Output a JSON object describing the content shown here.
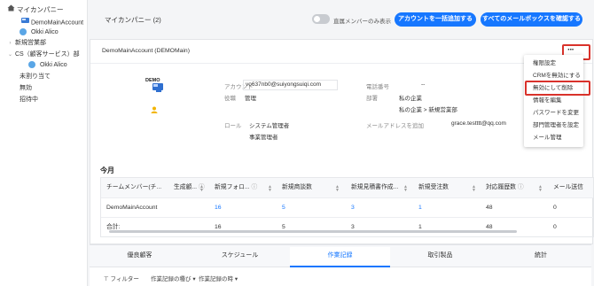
{
  "sidebar": {
    "root_label": "マイカンパニー",
    "items": [
      {
        "label": "DemoMainAccount"
      },
      {
        "label": "Okki Alico"
      },
      {
        "label": "新規営業部"
      },
      {
        "label": "CS（顧客サービス）部"
      },
      {
        "label": "Okki Alico"
      },
      {
        "label": "未割り当て"
      },
      {
        "label": "無効"
      },
      {
        "label": "招待中"
      }
    ]
  },
  "topbar": {
    "company_title": "マイカンパニー (2)",
    "direct_only_label": "直属メンバーのみ表示",
    "bulk_add_button": "アカウントを一括追加する",
    "check_mailbox_button": "すべてのメールボックスを確認する"
  },
  "card": {
    "account_header": "DemoMainAccount (DEMOMain)",
    "more_label": "···",
    "logo_text": "DEMO",
    "fields": {
      "account_label": "アカウント",
      "account_value": "vo637nb0@suiyongsuiqi.com",
      "role_title_label": "役職",
      "role_title_value": "管理",
      "phone_label": "電話番号",
      "phone_value": "--",
      "department_label": "部署",
      "department_value1": "私の企業",
      "department_value2": "私の企業 > 新規営業部",
      "role_label": "ロール",
      "role_value1": "システム管理者",
      "role_value2": "事業管理者",
      "mail_label": "メールアドレスを追加",
      "mail_value": "grace.testttt@qq.com"
    },
    "month_title": "今月",
    "table": {
      "headers": [
        "チームメンバー(チ...",
        "生成顧...",
        "新規フォロ...",
        "新規商談数",
        "新規見積書作成...",
        "新規受注数",
        "対応履歴数",
        "メール送信"
      ],
      "rows": [
        [
          "DemoMainAccount",
          "",
          "16",
          "5",
          "3",
          "1",
          "48",
          "0"
        ],
        [
          "合計:",
          "",
          "16",
          "5",
          "3",
          "1",
          "48",
          "0"
        ]
      ]
    }
  },
  "menu": {
    "items": [
      "権限設定",
      "CRMを無効にする",
      "無効にして削除",
      "情報を編集",
      "パスワードを変更",
      "部門管理者を設定",
      "メール管理"
    ]
  },
  "tabs": [
    "優良顧客",
    "スケジュール",
    "作業記録",
    "取引製品",
    "統計"
  ],
  "active_tab": "作業記録",
  "filters": {
    "filter_label": "フィルター",
    "type_label": "作業記録の種び",
    "time_label": "作業記録の時"
  },
  "colors": {
    "accent": "#1677ff",
    "highlight": "#d9322b"
  }
}
